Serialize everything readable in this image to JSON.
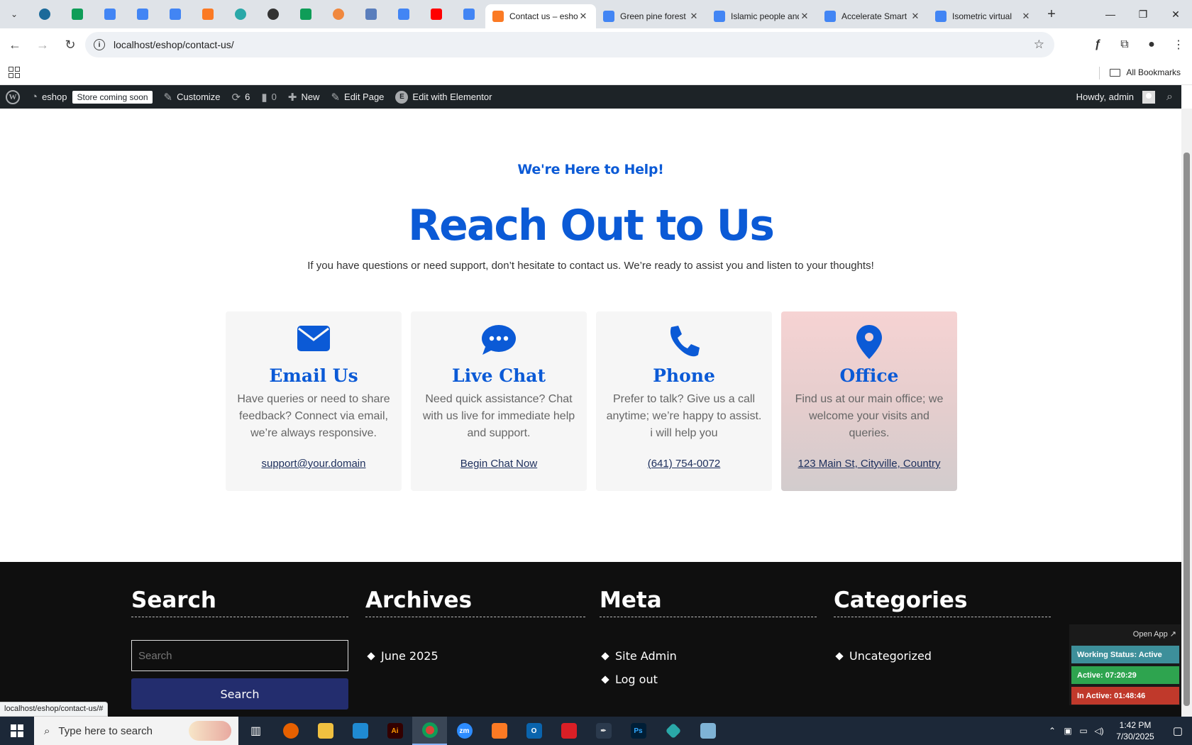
{
  "browser": {
    "pinned_tabs": [
      {
        "icon": "wordpress-icon",
        "color": "#1b6a9a"
      },
      {
        "icon": "sheets-icon",
        "color": "#0f9d58"
      },
      {
        "icon": "docs-icon",
        "color": "#4285f4"
      },
      {
        "icon": "docs-icon",
        "color": "#4285f4"
      },
      {
        "icon": "docs-icon",
        "color": "#4285f4"
      },
      {
        "icon": "xampp-icon",
        "color": "#fb7a24"
      },
      {
        "icon": "app-icon",
        "color": "#2aa8a8"
      },
      {
        "icon": "openai-icon",
        "color": "#333333"
      },
      {
        "icon": "sheets-icon",
        "color": "#0f9d58"
      },
      {
        "icon": "flame-icon",
        "color": "#f0883e"
      },
      {
        "icon": "qr-icon",
        "color": "#5a7ebc"
      },
      {
        "icon": "forms-icon",
        "color": "#4285f4"
      },
      {
        "icon": "youtube-icon",
        "color": "#ff0000"
      },
      {
        "icon": "forms-icon",
        "color": "#4285f4"
      }
    ],
    "tabs": [
      {
        "title": "Contact us – eshop",
        "icon": "xampp-icon",
        "color": "#fb7a24",
        "active": true
      },
      {
        "title": "Green pine forest",
        "icon": "docs-icon",
        "color": "#4285f4",
        "active": false
      },
      {
        "title": "Islamic people and",
        "icon": "docs-icon",
        "color": "#4285f4",
        "active": false
      },
      {
        "title": "Accelerate Smart",
        "icon": "docs-icon",
        "color": "#4285f4",
        "active": false
      },
      {
        "title": "Isometric virtual",
        "icon": "docs-icon",
        "color": "#4285f4",
        "active": false
      }
    ],
    "url": "localhost/eshop/contact-us/",
    "bookmarks_label": "All Bookmarks",
    "status_url": "localhost/eshop/contact-us/#"
  },
  "adminbar": {
    "site": "eshop",
    "coming_soon": "Store coming soon",
    "customize": "Customize",
    "updates": "6",
    "comments": "0",
    "new": "New",
    "edit_page": "Edit Page",
    "elementor": "Edit with Elementor",
    "howdy": "Howdy, admin"
  },
  "hero": {
    "eyebrow": "We're Here to Help!",
    "title": "Reach Out to Us",
    "subtitle": "If you have questions or need support, don’t hesitate to contact us. We’re ready to assist you and listen to your thoughts!"
  },
  "cards": [
    {
      "title": "Email Us",
      "desc": "Have queries or need to share feedback? Connect via email, we’re always responsive.",
      "link": "support@your.domain"
    },
    {
      "title": "Live Chat",
      "desc": "Need quick assistance? Chat with us live for immediate help and support.",
      "link": "Begin Chat Now"
    },
    {
      "title": "Phone",
      "desc": "Prefer to talk? Give us a call anytime; we’re happy to assist. i will help you",
      "link": "(641) 754-0072"
    },
    {
      "title": "Office",
      "desc": "Find us at our main office; we welcome your visits and queries.",
      "link": "123 Main St, Cityville, Country"
    }
  ],
  "footer": {
    "search": {
      "title": "Search",
      "placeholder": "Search",
      "button": "Search"
    },
    "archives": {
      "title": "Archives",
      "items": [
        "June 2025"
      ]
    },
    "meta": {
      "title": "Meta",
      "items": [
        "Site Admin",
        "Log out"
      ]
    },
    "categories": {
      "title": "Categories",
      "items": [
        "Uncategorized"
      ]
    }
  },
  "widget": {
    "open_app": "Open App ↗",
    "working_status": "Working Status: Active",
    "active": "Active: 07:20:29",
    "inactive": "In Active: 01:48:46",
    "colors": {
      "status": "#3d8f9a",
      "active": "#2ea44f",
      "inactive": "#c0392b"
    }
  },
  "taskbar": {
    "search_placeholder": "Type here to search",
    "time": "1:42 PM",
    "date": "7/30/2025"
  },
  "colors": {
    "accent": "#0b5ad6",
    "footer_bg": "#0f0f0f",
    "search_button": "#232d6e"
  }
}
